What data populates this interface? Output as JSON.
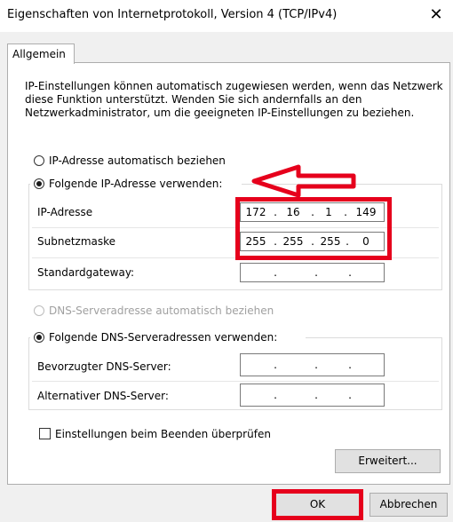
{
  "window": {
    "title": "Eigenschaften von Internetprotokoll, Version 4 (TCP/IPv4)",
    "close_symbol": "✕"
  },
  "tabs": [
    {
      "label": "Allgemein",
      "selected": true
    }
  ],
  "description": "IP-Einstellungen können automatisch zugewiesen werden, wenn das Netzwerk diese Funktion unterstützt. Wenden Sie sich andernfalls an den Netzwerkadministrator, um die geeigneten IP-Einstellungen zu beziehen.",
  "ip": {
    "auto_label": "IP-Adresse automatisch beziehen",
    "manual_label": "Folgende IP-Adresse verwenden:",
    "selected": "manual",
    "fields": [
      {
        "label": "IP-Adresse",
        "octets": [
          "172",
          "16",
          "1",
          "149"
        ]
      },
      {
        "label": "Subnetzmaske",
        "octets": [
          "255",
          "255",
          "255",
          "0"
        ]
      },
      {
        "label": "Standardgateway:",
        "octets": [
          "",
          "",
          "",
          ""
        ]
      }
    ]
  },
  "dns": {
    "auto_label": "DNS-Serveradresse automatisch beziehen",
    "manual_label": "Folgende DNS-Serveradressen verwenden:",
    "selected": "manual",
    "fields": [
      {
        "label": "Bevorzugter DNS-Server:",
        "octets": [
          "",
          "",
          "",
          ""
        ]
      },
      {
        "label": "Alternativer DNS-Server:",
        "octets": [
          "",
          "",
          "",
          ""
        ]
      }
    ]
  },
  "validate_label": "Einstellungen beim Beenden überprüfen",
  "validate_checked": false,
  "buttons": {
    "advanced": "Erweitert...",
    "ok": "OK",
    "cancel": "Abbrechen"
  },
  "annotation_color": "#e6001c"
}
